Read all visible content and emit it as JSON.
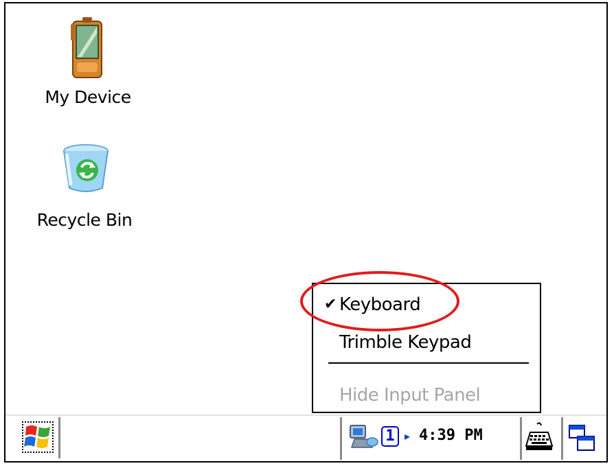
{
  "desktop": {
    "icons": [
      {
        "label": "My Device",
        "icon": "pda-device-icon"
      },
      {
        "label": "Recycle Bin",
        "icon": "recycle-bin-icon"
      }
    ]
  },
  "input_menu": {
    "items": [
      {
        "label": "Keyboard",
        "checked": true,
        "check_glyph": "✔",
        "enabled": true
      },
      {
        "label": "Trimble Keypad",
        "checked": false,
        "enabled": true
      },
      {
        "label": "Hide Input Panel",
        "checked": false,
        "enabled": false
      }
    ]
  },
  "taskbar": {
    "start_icon": "windows-flag-icon",
    "input_number": "1",
    "tray_arrow": "▸",
    "clock": "4:39 PM",
    "network_icon": "network-connected-icon",
    "keyboard_icon": "keyboard-icon",
    "window_switch_icon": "window-switch-icon"
  },
  "colors": {
    "highlight": "#e31b1b",
    "disabled_text": "#a6a6a6",
    "tray_blue": "#0000cc"
  }
}
